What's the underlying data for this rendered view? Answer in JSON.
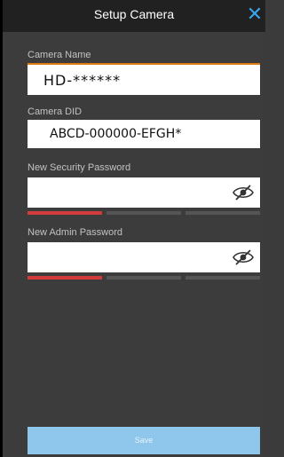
{
  "header": {
    "title": "Setup Camera",
    "close_icon": "close-icon"
  },
  "camera_name": {
    "label": "Camera Name",
    "value": "HD-******"
  },
  "camera_did": {
    "label": "Camera DID",
    "value": "ABCD-000000-EFGH*"
  },
  "security_password": {
    "label": "New Security Password",
    "value": "",
    "toggle_icon": "eye-slash-icon",
    "strength_level": "1 of 3",
    "strength_colors": [
      "#d33a3a",
      "#555555",
      "#555555"
    ]
  },
  "admin_password": {
    "label": "New Admin Password",
    "value": "",
    "toggle_icon": "eye-slash-icon",
    "strength_level": "1 of 3",
    "strength_colors": [
      "#d33a3a",
      "#555555",
      "#555555"
    ]
  },
  "actions": {
    "save_label": "Save",
    "save_color": "#8ec6ec"
  },
  "colors": {
    "accent": "#39a3ec",
    "focus_underline": "#e07a10"
  }
}
